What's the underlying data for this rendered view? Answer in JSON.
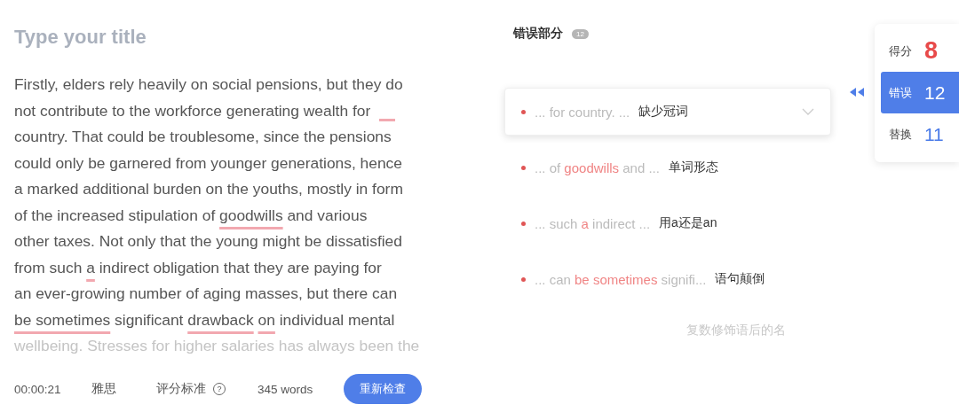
{
  "editor": {
    "title_placeholder": "Type your title",
    "lines": [
      {
        "faded": false,
        "segments": [
          {
            "kind": "text",
            "text": "Firstly, elders rely heavily on social pensions, but they do"
          }
        ]
      },
      {
        "faded": false,
        "segments": [
          {
            "kind": "text",
            "text": "not contribute to the workforce generating wealth for"
          },
          {
            "kind": "gap"
          }
        ]
      },
      {
        "faded": false,
        "segments": [
          {
            "kind": "text",
            "text": "country. That could be troublesome, since the pensions"
          }
        ]
      },
      {
        "faded": false,
        "segments": [
          {
            "kind": "text",
            "text": "could only be garnered from younger generations, hence"
          }
        ]
      },
      {
        "faded": false,
        "segments": [
          {
            "kind": "text",
            "text": "a marked additional burden on the youths, mostly in form"
          }
        ]
      },
      {
        "faded": false,
        "segments": [
          {
            "kind": "text",
            "text": "of the increased stipulation of "
          },
          {
            "kind": "error",
            "text": "goodwills"
          },
          {
            "kind": "text",
            "text": " and various"
          }
        ]
      },
      {
        "faded": false,
        "segments": [
          {
            "kind": "text",
            "text": "other taxes. Not only that the young might be dissatisfied"
          }
        ]
      },
      {
        "faded": false,
        "segments": [
          {
            "kind": "text",
            "text": "from such "
          },
          {
            "kind": "error",
            "text": "a"
          },
          {
            "kind": "text",
            "text": " indirect obligation that they are paying for"
          }
        ]
      },
      {
        "faded": false,
        "segments": [
          {
            "kind": "text",
            "text": "an ever-growing number of aging masses, but there can"
          }
        ]
      },
      {
        "faded": false,
        "segments": [
          {
            "kind": "error",
            "text": "be sometimes"
          },
          {
            "kind": "text",
            "text": " significant "
          },
          {
            "kind": "error",
            "text": "drawback"
          },
          {
            "kind": "error",
            "text": "on"
          },
          {
            "kind": "text",
            "text": " individual mental"
          }
        ]
      },
      {
        "faded": true,
        "segments": [
          {
            "kind": "text",
            "text": "wellbeing. Stresses for higher salaries has always been the"
          }
        ]
      }
    ]
  },
  "footer": {
    "timer": "00:00:21",
    "exam": "雅思",
    "criteria": "评分标准",
    "help": "?",
    "word_count": "345 words",
    "recheck_button": "重新检查"
  },
  "errors": {
    "title": "错误部分",
    "count": "12",
    "items": [
      {
        "expanded": true,
        "faded": false,
        "snippet": [
          {
            "text": "... for country. ...",
            "error": false
          }
        ],
        "type": "缺少冠词"
      },
      {
        "expanded": false,
        "faded": false,
        "snippet": [
          {
            "text": "... of ",
            "error": false
          },
          {
            "text": "goodwills",
            "error": true
          },
          {
            "text": " and ...",
            "error": false
          }
        ],
        "type": "单词形态"
      },
      {
        "expanded": false,
        "faded": false,
        "snippet": [
          {
            "text": "... such ",
            "error": false
          },
          {
            "text": "a",
            "error": true
          },
          {
            "text": " indirect ...",
            "error": false
          }
        ],
        "type": "用a还是an"
      },
      {
        "expanded": false,
        "faded": false,
        "snippet": [
          {
            "text": "... can ",
            "error": false
          },
          {
            "text": "be sometimes",
            "error": true
          },
          {
            "text": " signifi...",
            "error": false
          }
        ],
        "type": "语句颠倒"
      },
      {
        "expanded": false,
        "faded": true,
        "type": "复数修饰语后的名"
      }
    ]
  },
  "summary": [
    {
      "label": "得分",
      "value": "8",
      "selected": false,
      "color": "#e84a4a"
    },
    {
      "label": "错误",
      "value": "12",
      "selected": true,
      "color": "#ffffff"
    },
    {
      "label": "替换",
      "value": "11",
      "selected": false,
      "color": "#4a7be8"
    }
  ]
}
